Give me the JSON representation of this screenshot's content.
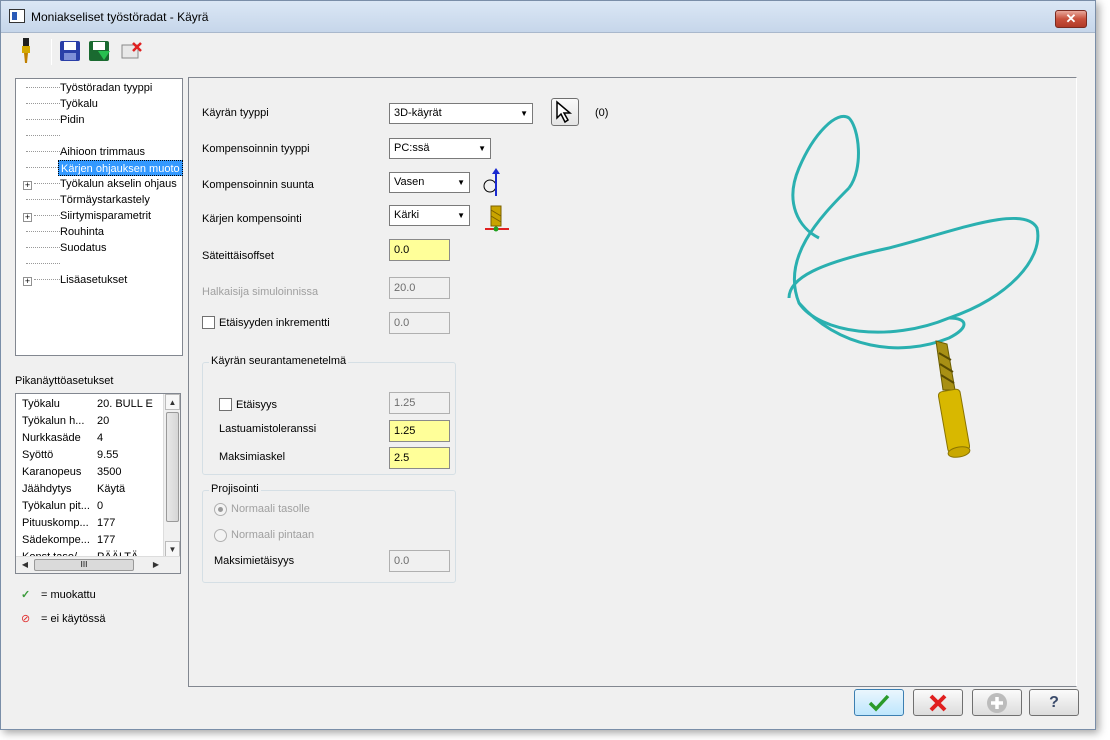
{
  "window": {
    "title": "Moniakseliset työstöradat - Käyrä",
    "close_label": "✕"
  },
  "toolbar": {
    "icons": [
      "tool-icon",
      "save-icon",
      "save-and-calc-icon",
      "delete-icon"
    ]
  },
  "tree": {
    "items": [
      {
        "label": "Työstöradan tyyppi"
      },
      {
        "label": "Työkalu"
      },
      {
        "label": "Pidin"
      },
      {
        "label": ""
      },
      {
        "label": "Aihioon trimmaus"
      },
      {
        "label": "Kärjen ohjauksen muoto"
      },
      {
        "label": "Työkalun akselin ohjaus"
      },
      {
        "label": "Törmäystarkastely"
      },
      {
        "label": "Siirtymisparametrit"
      },
      {
        "label": "Rouhinta"
      },
      {
        "label": "Suodatus"
      },
      {
        "label": ""
      },
      {
        "label": "Lisäasetukset"
      }
    ]
  },
  "quick": {
    "title": "Pikanäyttöasetukset",
    "rows": [
      {
        "k": "Työkalu",
        "v": "20. BULL E"
      },
      {
        "k": "Työkalun h...",
        "v": "20"
      },
      {
        "k": "Nurkkasäde",
        "v": "4"
      },
      {
        "k": "Syöttö",
        "v": "9.55"
      },
      {
        "k": "Karanopeus",
        "v": "3500"
      },
      {
        "k": "Jäähdytys",
        "v": "Käytä"
      },
      {
        "k": "Työkalun pit...",
        "v": "0"
      },
      {
        "k": "Pituuskomp...",
        "v": "177"
      },
      {
        "k": "Sädekompe...",
        "v": "177"
      },
      {
        "k": "Konst.taso/...",
        "v": "PÄÄLTÄ"
      }
    ],
    "hscroll_label": "III"
  },
  "legend": {
    "modified": "= muokattu",
    "disabled": "= ei käytössä"
  },
  "form": {
    "curve_type_label": "Käyrän tyyppi",
    "curve_type_value": "3D-käyrät",
    "pick_count": "(0)",
    "comp_type_label": "Kompensoinnin tyyppi",
    "comp_type_value": "PC:ssä",
    "comp_dir_label": "Kompensoinnin suunta",
    "comp_dir_value": "Vasen",
    "tip_comp_label": "Kärjen kompensointi",
    "tip_comp_value": "Kärki",
    "radial_offset_label": "Säteittäisoffset",
    "radial_offset_value": "0.0",
    "sim_diameter_label": "Halkaisija simuloinnissa",
    "sim_diameter_value": "20.0",
    "depth_incr_label": "Etäisyyden inkrementti",
    "depth_incr_value": "0.0",
    "tracking_group": "Käyrän seurantamenetelmä",
    "distance_label": "Etäisyys",
    "distance_value": "1.25",
    "chordal_label": "Lastuamistoleranssi",
    "chordal_value": "1.25",
    "max_step_label": "Maksimiaskel",
    "max_step_value": "2.5",
    "projection_group": "Projisointi",
    "normal_plane_label": "Normaali tasolle",
    "normal_surface_label": "Normaali pintaan",
    "max_distance_label": "Maksimietäisyys",
    "max_distance_value": "0.0"
  },
  "buttons": {
    "ok": "check-icon",
    "cancel": "cross-icon",
    "add": "plus-icon",
    "help": "?"
  },
  "colors": {
    "curve": "#2ab0b0",
    "tool_gold": "#d8b800",
    "highlight_field": "#ffff99",
    "selection": "#3399ff"
  }
}
